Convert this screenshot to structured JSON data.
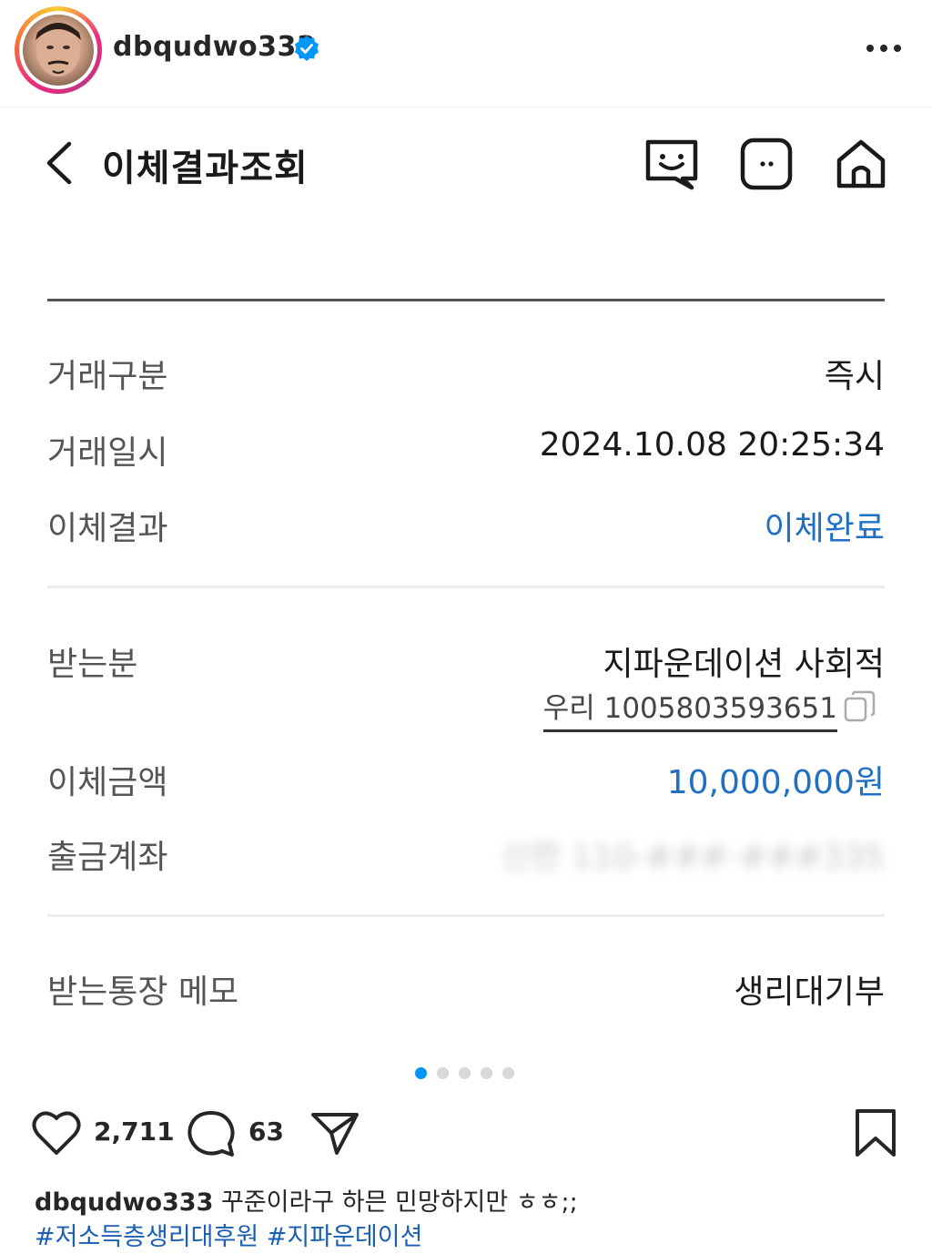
{
  "post": {
    "username": "dbqudwo333",
    "verified": true
  },
  "bank_screen": {
    "title": "이체결과조회",
    "rows": {
      "transaction_type": {
        "label": "거래구분",
        "value": "즉시"
      },
      "transaction_datetime": {
        "label": "거래일시",
        "value": "2024.10.08 20:25:34"
      },
      "transfer_result": {
        "label": "이체결과",
        "value": "이체완료"
      },
      "recipient": {
        "label": "받는분",
        "value": "지파운데이션 사회적",
        "account": "우리 1005803593651"
      },
      "transfer_amount": {
        "label": "이체금액",
        "value": "10,000,000원"
      },
      "withdrawal_account": {
        "label": "출금계좌",
        "value": "신한 110-###-###335"
      },
      "recipient_memo": {
        "label": "받는통장 메모",
        "value": "생리대기부"
      }
    }
  },
  "carousel": {
    "count": 5,
    "active_index": 0
  },
  "actions": {
    "likes": "2,711",
    "comments": "63"
  },
  "caption": {
    "username": "dbqudwo333",
    "text": "꾸준이라구 하믄 민망하지만 ㅎㅎ;;",
    "hashtags": [
      "#저소득층생리대후원",
      "#지파운데이션"
    ]
  },
  "colors": {
    "accent_blue": "#1f6fc4",
    "carousel_active": "#0095f6",
    "hashtag": "#1a5fb4"
  },
  "icons": [
    "verified-badge-icon",
    "more-options-icon",
    "back-chevron-icon",
    "chatbot-icon",
    "menu-icon",
    "home-icon",
    "copy-icon",
    "heart-icon",
    "comment-icon",
    "share-icon",
    "bookmark-icon"
  ]
}
